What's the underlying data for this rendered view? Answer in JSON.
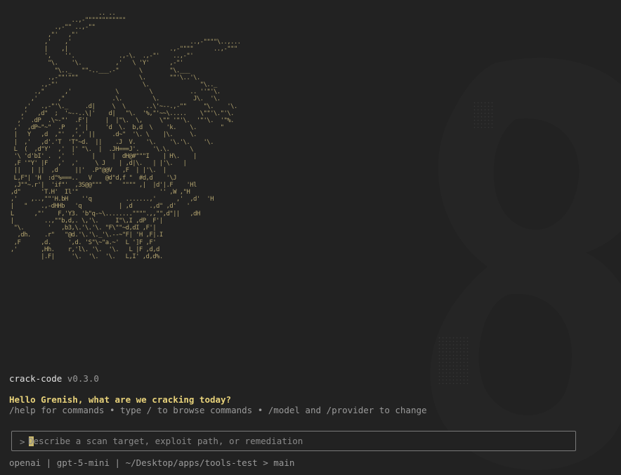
{
  "app": {
    "name": "crack-code",
    "version": "v0.3.0"
  },
  "greeting": "Hello Grenish, what are we cracking today?",
  "hint": "/help for commands • type / to browse commands • /model and /provider to change",
  "prompt": {
    "symbol": ">",
    "placeholder": "Describe a scan target, exploit path, or remediation",
    "value": ""
  },
  "status": {
    "text": "openai | gpt-5-mini | ~/Desktop/apps/tools-test > main"
  },
  "colors": {
    "background": "#222222",
    "accent": "#e8d27a",
    "ascii": "#b8a872",
    "muted": "#9a9a9a"
  },
  "icons": {
    "background": "logo-watermark-icon"
  }
}
